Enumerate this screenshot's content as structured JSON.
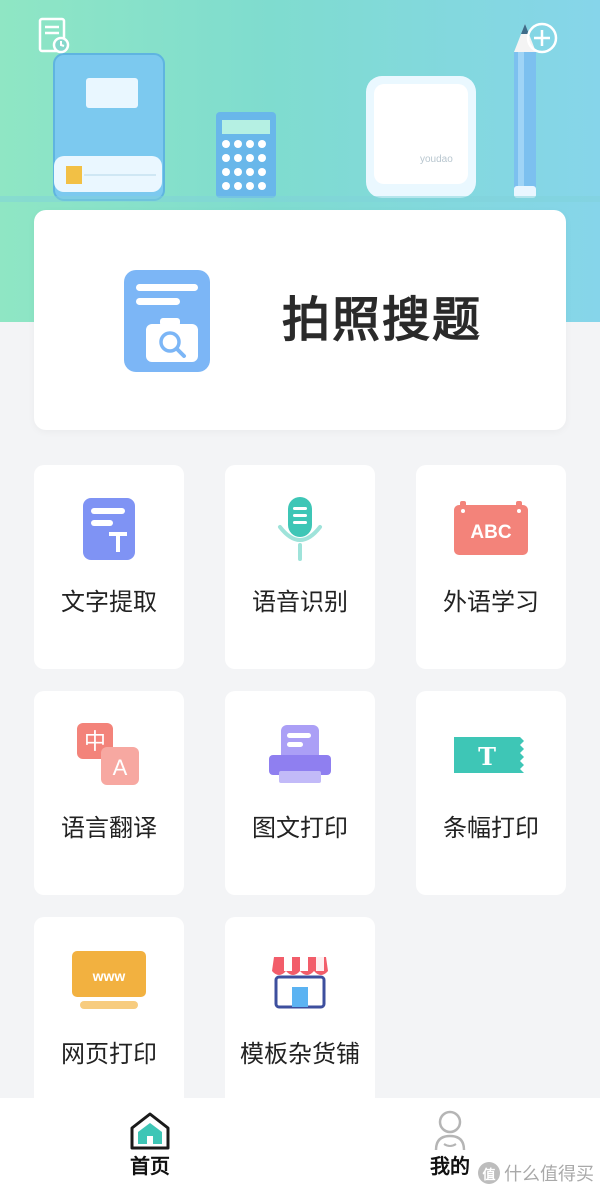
{
  "header": {
    "history_icon": "history-icon",
    "add_icon": "add-circle-icon",
    "illustration_brand": "youdao"
  },
  "main_feature": {
    "label": "拍照搜题",
    "icon": "photo-search-icon"
  },
  "features": [
    {
      "label": "文字提取",
      "icon": "text-extract-icon"
    },
    {
      "label": "语音识别",
      "icon": "microphone-icon"
    },
    {
      "label": "外语学习",
      "icon": "abc-icon",
      "icon_text": "ABC"
    },
    {
      "label": "语言翻译",
      "icon": "translate-icon",
      "icon_text_cn": "中",
      "icon_text_en": "A"
    },
    {
      "label": "图文打印",
      "icon": "printer-icon"
    },
    {
      "label": "条幅打印",
      "icon": "banner-icon",
      "icon_text": "T"
    },
    {
      "label": "网页打印",
      "icon": "webpage-icon",
      "icon_text": "www"
    },
    {
      "label": "模板杂货铺",
      "icon": "store-icon"
    }
  ],
  "bottom_nav": {
    "home_label": "首页",
    "mine_label": "我的"
  },
  "watermark": {
    "text": "什么值得买",
    "badge": "值"
  },
  "colors": {
    "header_green": "#8fe6c4",
    "header_blue": "#86d5ea",
    "blue_icon": "#7cb6f6",
    "teal": "#3ec6b6",
    "salmon": "#f3837a",
    "purple": "#8f7ff0",
    "orange": "#f2b140"
  }
}
